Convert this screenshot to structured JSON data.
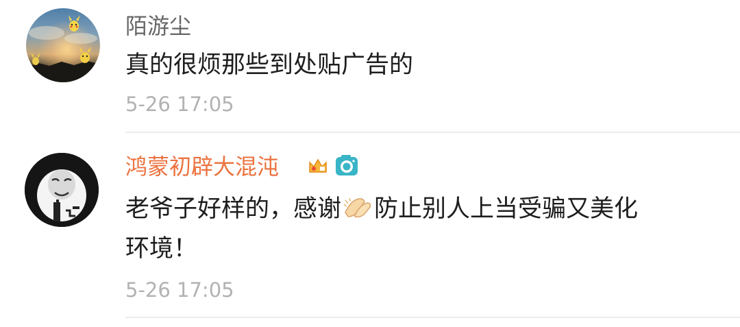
{
  "comments": [
    {
      "username": "陌游尘",
      "username_color": "#666666",
      "text": "真的很烦那些到处贴广告的",
      "timestamp": "5-26 17:05"
    },
    {
      "username": "鸿蒙初辟大混沌",
      "username_color": "#eb7340",
      "badges": [
        "crown-badge-icon",
        "camera-badge-icon"
      ],
      "text_before_emoji": "老爷子好样的，感谢",
      "emoji": "clap-emoji-icon",
      "text_after_emoji": "防止别人上当受骗又美化",
      "text_line2": "环境！",
      "timestamp": "5-26 17:05"
    }
  ],
  "colors": {
    "text": "#1e1e1e",
    "timestamp": "#b2b2b2",
    "vip_name": "#eb7340",
    "divider": "#ececec"
  }
}
